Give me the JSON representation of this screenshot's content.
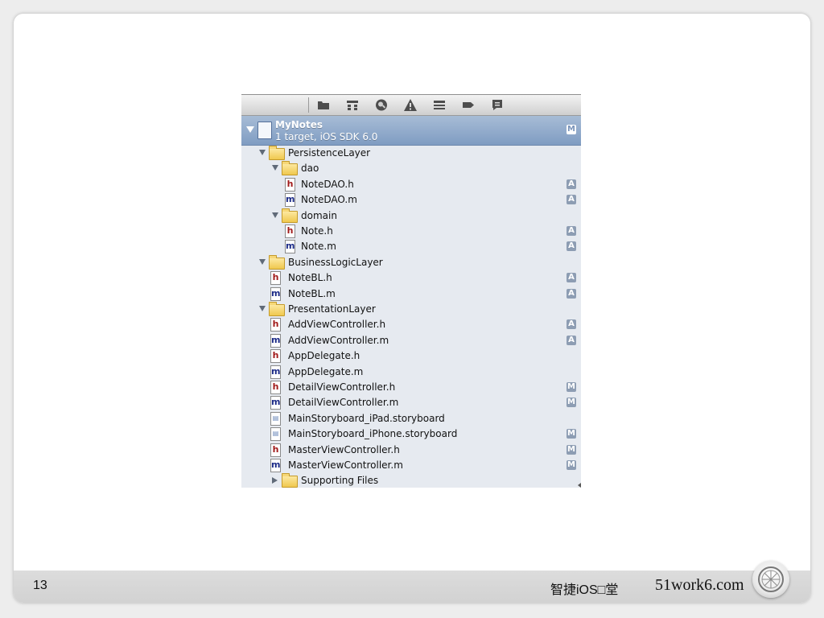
{
  "navigator": {
    "toolbar_icons": [
      "folder-icon",
      "hierarchy-icon",
      "search-icon",
      "warning-icon",
      "list-icon",
      "tag-icon",
      "comment-icon"
    ],
    "project": {
      "name": "MyNotes",
      "subtitle": "1 target, iOS SDK 6.0",
      "badge": "M"
    },
    "tree": [
      {
        "label": "PersistenceLayer",
        "kind": "folder",
        "depth": 1,
        "expanded": true,
        "badge": ""
      },
      {
        "label": "dao",
        "kind": "folder",
        "depth": 2,
        "expanded": true,
        "badge": ""
      },
      {
        "label": "NoteDAO.h",
        "kind": "h",
        "depth": 3,
        "badge": "A"
      },
      {
        "label": "NoteDAO.m",
        "kind": "m",
        "depth": 3,
        "badge": "A"
      },
      {
        "label": "domain",
        "kind": "folder",
        "depth": 2,
        "expanded": true,
        "badge": ""
      },
      {
        "label": "Note.h",
        "kind": "h",
        "depth": 3,
        "badge": "A"
      },
      {
        "label": "Note.m",
        "kind": "m",
        "depth": 3,
        "badge": "A"
      },
      {
        "label": "BusinessLogicLayer",
        "kind": "folder",
        "depth": 1,
        "expanded": true,
        "badge": ""
      },
      {
        "label": "NoteBL.h",
        "kind": "h",
        "depth": 2,
        "badge": "A"
      },
      {
        "label": "NoteBL.m",
        "kind": "m",
        "depth": 2,
        "badge": "A"
      },
      {
        "label": "PresentationLayer",
        "kind": "folder",
        "depth": 1,
        "expanded": true,
        "badge": ""
      },
      {
        "label": "AddViewController.h",
        "kind": "h",
        "depth": 2,
        "badge": "A"
      },
      {
        "label": "AddViewController.m",
        "kind": "m",
        "depth": 2,
        "badge": "A"
      },
      {
        "label": "AppDelegate.h",
        "kind": "h",
        "depth": 2,
        "badge": ""
      },
      {
        "label": "AppDelegate.m",
        "kind": "m",
        "depth": 2,
        "badge": ""
      },
      {
        "label": "DetailViewController.h",
        "kind": "h",
        "depth": 2,
        "badge": "M"
      },
      {
        "label": "DetailViewController.m",
        "kind": "m",
        "depth": 2,
        "badge": "M"
      },
      {
        "label": "MainStoryboard_iPad.storyboard",
        "kind": "sb",
        "depth": 2,
        "badge": ""
      },
      {
        "label": "MainStoryboard_iPhone.storyboard",
        "kind": "sb",
        "depth": 2,
        "badge": "M"
      },
      {
        "label": "MasterViewController.h",
        "kind": "h",
        "depth": 2,
        "badge": "M"
      },
      {
        "label": "MasterViewController.m",
        "kind": "m",
        "depth": 2,
        "badge": "M"
      },
      {
        "label": "Supporting Files",
        "kind": "folder",
        "depth": 2,
        "expanded": false,
        "badge": ""
      }
    ]
  },
  "footer": {
    "page_number": "13",
    "brand": "智捷iOS□堂",
    "site": "51work6.com"
  }
}
